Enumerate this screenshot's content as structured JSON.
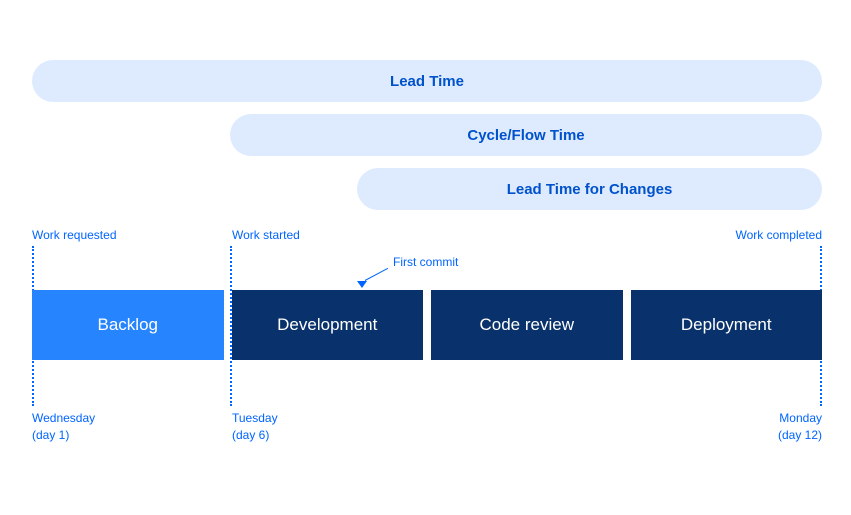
{
  "metrics": {
    "lead_time": "Lead Time",
    "cycle_time": "Cycle/Flow Time",
    "lead_time_changes": "Lead Time for Changes"
  },
  "events": {
    "requested": "Work requested",
    "started": "Work started",
    "completed": "Work completed"
  },
  "annotation": {
    "first_commit": "First commit"
  },
  "stages": {
    "backlog": "Backlog",
    "development": "Development",
    "code_review": "Code review",
    "deployment": "Deployment"
  },
  "days": {
    "d1_name": "Wednesday",
    "d1_num": "(day 1)",
    "d2_name": "Tuesday",
    "d2_num": "(day 6)",
    "d3_name": "Monday",
    "d3_num": "(day 12)"
  }
}
